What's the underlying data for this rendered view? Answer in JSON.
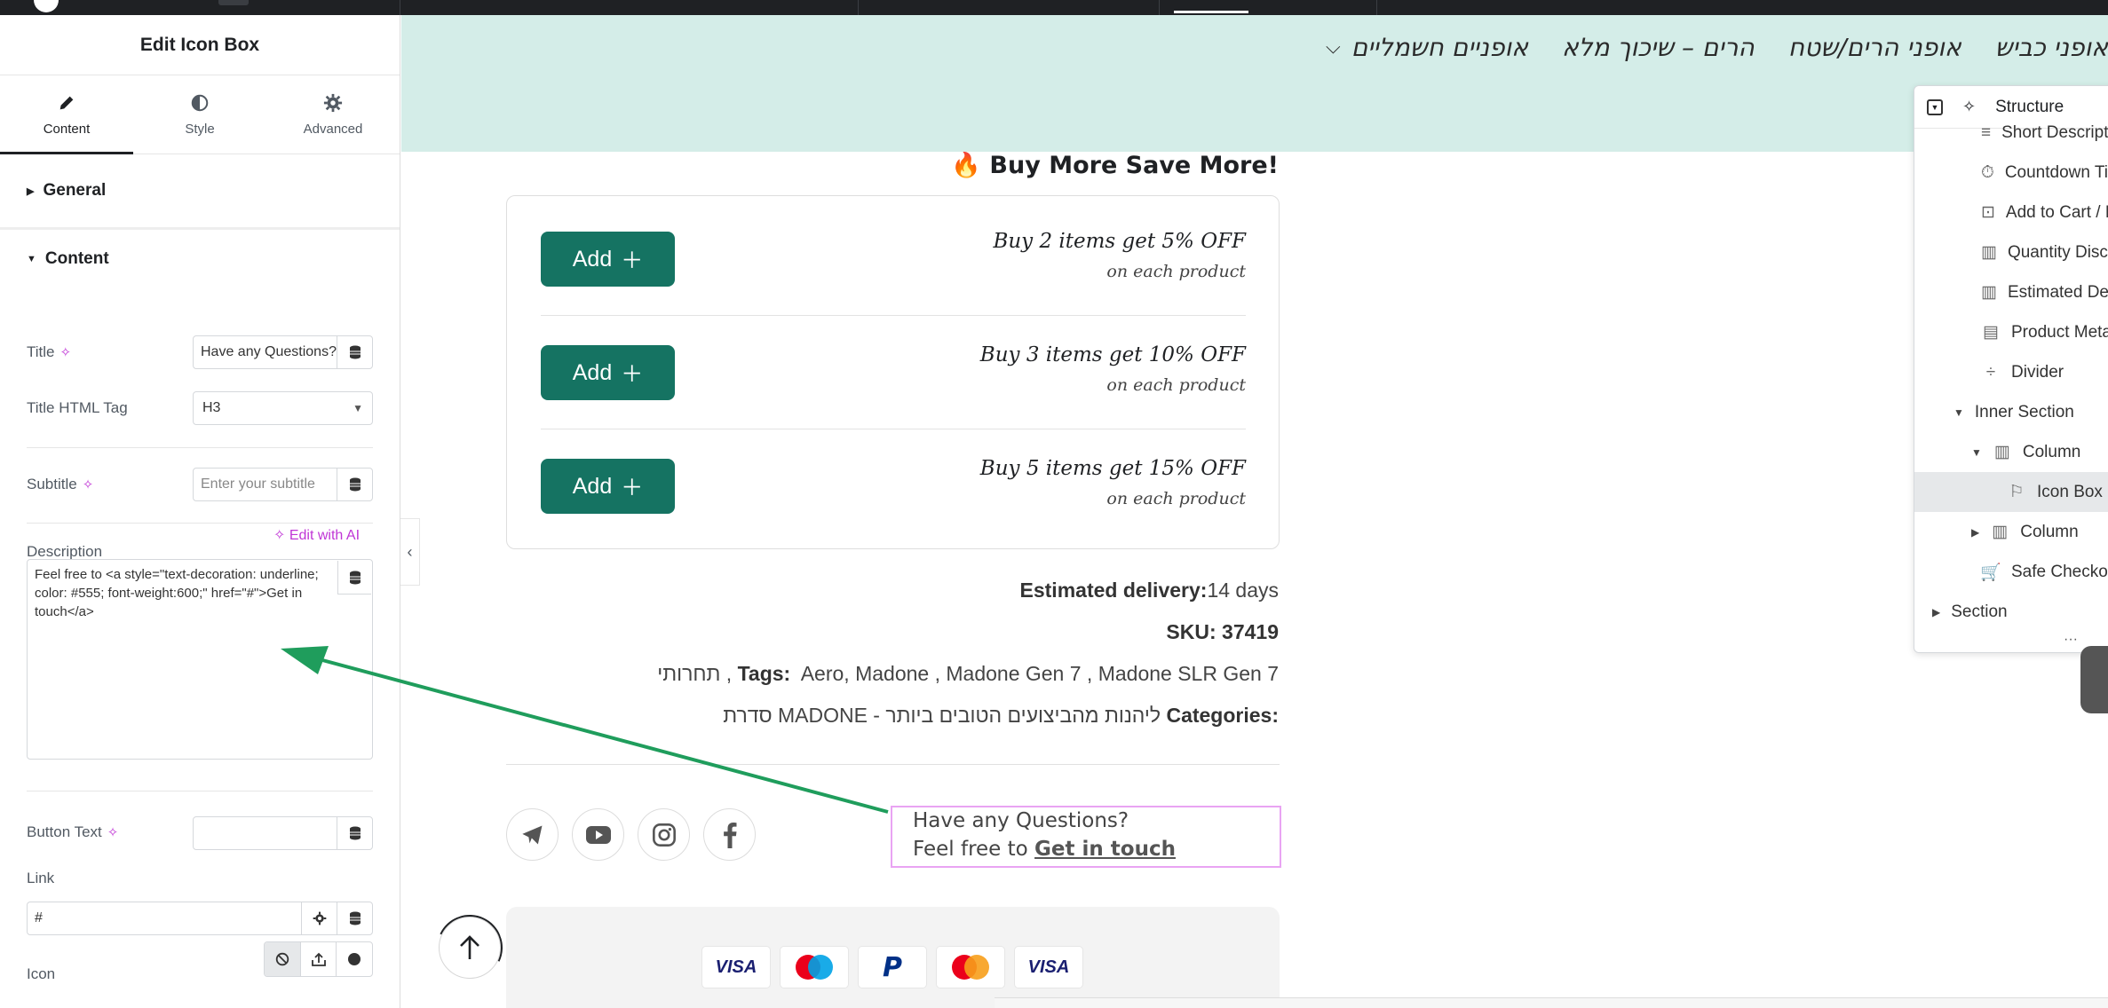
{
  "colors": {
    "accent_teal": "#157362",
    "header_bg": "#d4ede8",
    "ai_magenta": "#c036d6",
    "selection_border": "#e9a4f3",
    "arrow_green": "#1f9d5c"
  },
  "panel": {
    "title": "Edit Icon Box",
    "tabs": [
      {
        "label": "Content",
        "icon": "pencil-icon"
      },
      {
        "label": "Style",
        "icon": "half-circle-icon"
      },
      {
        "label": "Advanced",
        "icon": "gear-icon"
      }
    ],
    "sections": {
      "general": "General",
      "content": "Content"
    },
    "fields": {
      "title_label": "Title",
      "title_value": "Have any Questions?",
      "title_tag_label": "Title HTML Tag",
      "title_tag_value": "H3",
      "subtitle_label": "Subtitle",
      "subtitle_placeholder": "Enter your subtitle",
      "description_label": "Description",
      "edit_with_ai": "Edit with AI",
      "description_value": "Feel free to <a style=\"text-decoration: underline; color: #555; font-weight:600;\" href=\"#\">Get in touch</a>",
      "button_text_label": "Button Text",
      "button_text_value": "",
      "link_label": "Link",
      "link_value": "#",
      "icon_label": "Icon"
    }
  },
  "nav": {
    "items": [
      "אופניים חשמליים",
      "הרים – שיכוך מלא",
      "אופני הרים/שטח",
      "אופני כביש"
    ]
  },
  "promo": {
    "title": "Buy More Save More!",
    "emoji": "🔥",
    "add_label": "Add",
    "offers": [
      {
        "main": "Buy 2 items get 5% OFF",
        "sub": "on each product"
      },
      {
        "main": "Buy 3 items get 10% OFF",
        "sub": "on each product"
      },
      {
        "main": "Buy 5 items get 15% OFF",
        "sub": "on each product"
      }
    ]
  },
  "product_meta": {
    "delivery_label": "Estimated delivery:",
    "delivery_value": "14 days",
    "sku_label": "SKU:",
    "sku_value": "37419",
    "tags_label": "Tags:",
    "tags_value": "Aero, Madone , Madone Gen 7 , Madone SLR Gen 7",
    "tags_extra": "תחרותי ,",
    "categories_label": "Categories:",
    "categories_value": "סדרת MADONE - ליהנות מהביצועים הטובים ביותר"
  },
  "iconbox": {
    "title": "Have any Questions?",
    "desc_prefix": "Feel free to",
    "desc_link": "Get in touch"
  },
  "social": [
    "telegram-icon",
    "youtube-icon",
    "instagram-icon",
    "facebook-icon"
  ],
  "payments": [
    "VISA",
    "Maestro",
    "PayPal",
    "Mastercard",
    "VISA"
  ],
  "structure": {
    "title": "Structure",
    "items": [
      {
        "label": "Short Description",
        "icon": "text-lines-icon"
      },
      {
        "label": "Countdown Timer",
        "icon": "stopwatch-icon"
      },
      {
        "label": "Add to Cart / Buy Now",
        "icon": "cart-button-icon"
      },
      {
        "label": "Quantity Discounts",
        "icon": "bar-chart-icon"
      },
      {
        "label": "Estimated Delivery",
        "icon": "bar-chart-icon"
      },
      {
        "label": "Product Meta",
        "icon": "meta-icon"
      },
      {
        "label": "Divider",
        "icon": "divider-icon"
      },
      {
        "label": "Inner Section",
        "icon": "caret-down-icon"
      },
      {
        "label": "Column",
        "icon": "column-icon"
      },
      {
        "label": "Icon Box",
        "icon": "flag-icon"
      },
      {
        "label": "Column",
        "icon": "column-icon"
      },
      {
        "label": "Safe Checkout",
        "icon": "cart-icon"
      },
      {
        "label": "Section",
        "icon": "caret-right-icon"
      }
    ]
  }
}
